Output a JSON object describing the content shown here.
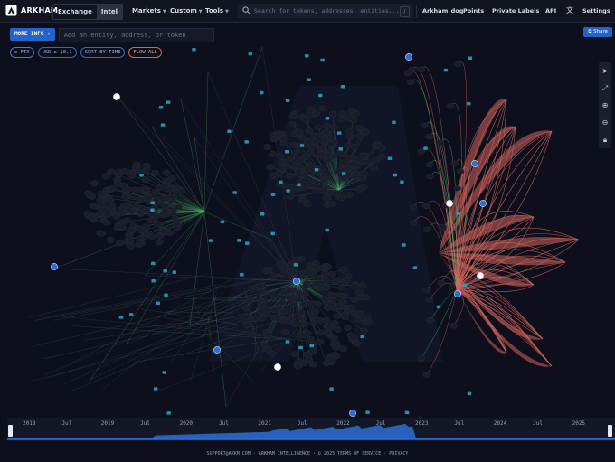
{
  "header": {
    "brand": "ARKHAM",
    "tabs": [
      {
        "label": "Exchange",
        "active": false
      },
      {
        "label": "Intel",
        "active": true
      }
    ],
    "menus": [
      {
        "label": "Markets"
      },
      {
        "label": "Custom"
      },
      {
        "label": "Tools"
      }
    ],
    "search": {
      "placeholder": "Search for tokens, addresses, entities...",
      "shortcut": "/"
    },
    "user": "Arkham_dog",
    "links": [
      "Points",
      "Private Labels",
      "API",
      "Settings"
    ]
  },
  "controls": {
    "more_info": "MORE INFO",
    "add_placeholder": "Add an entity, address, or token",
    "chips": [
      "FTX",
      "USD ≥ $0.1",
      "SORT BY TIME",
      "FLOW ALL"
    ],
    "share": "Share"
  },
  "colors": {
    "background": "#0d0f1c",
    "accent": "#2563c9",
    "node": "#1b1e2a",
    "inflow": "#4bb56a",
    "outflow": "#d3645c"
  },
  "timeline": {
    "labels": [
      "2018",
      "Jul",
      "2019",
      "Jul",
      "2020",
      "Jul",
      "2021",
      "Jul",
      "2022",
      "Jul",
      "2023",
      "Jul",
      "2024",
      "Jul",
      "2025"
    ]
  },
  "footer": "SUPPORT@ARKM.COM · ARKHAM INTELLIGENCE · © 2025  TERMS OF SERVICE · PRIVACY"
}
